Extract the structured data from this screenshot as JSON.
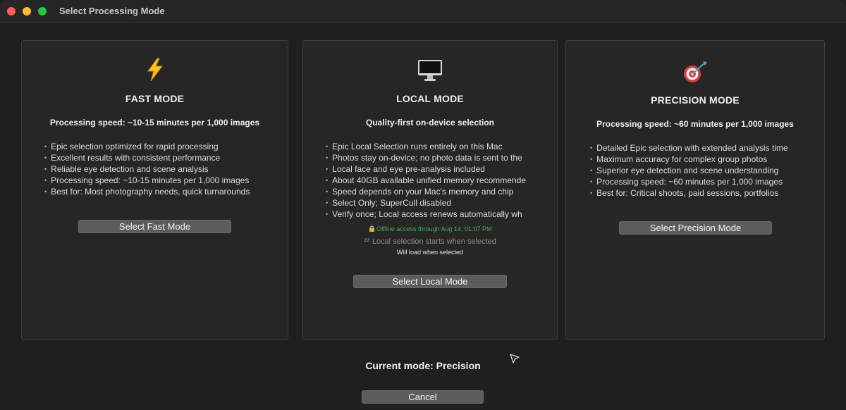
{
  "window": {
    "title": "Select Processing Mode"
  },
  "cards": {
    "fast": {
      "icon": "lightning-icon",
      "title": "FAST MODE",
      "subtitle": "Processing speed: ~10-15 minutes per 1,000 images",
      "bullets": [
        "Epic selection optimized for rapid processing",
        "Excellent results with consistent performance",
        "Reliable eye detection and scene analysis",
        "Processing speed: ~10-15 minutes per 1,000 images",
        "Best for: Most photography needs, quick turnarounds"
      ],
      "button": "Select Fast Mode"
    },
    "local": {
      "icon": "desktop-computer-icon",
      "title": "LOCAL MODE",
      "subtitle": "Quality-first on-device selection",
      "bullets": [
        "Epic Local Selection runs entirely on this Mac",
        "Photos stay on-device; no photo data is sent to the",
        "Local face and eye pre-analysis included",
        "About 40GB available unified memory recommende",
        "Speed depends on your Mac's memory and chip",
        "Select Only; SuperCull disabled",
        "Verify once; Local access renews automatically wh"
      ],
      "offline_status": "Offline access through Aug 14, 01:07 PM",
      "selection_status": "Local selection starts when selected",
      "load_status": "Will load when selected",
      "button": "Select Local Mode"
    },
    "precision": {
      "icon": "target-icon",
      "title": "PRECISION MODE",
      "subtitle": "Processing speed: ~60 minutes per 1,000 images",
      "bullets": [
        "Detailed Epic selection with extended analysis time",
        "Maximum accuracy for complex group photos",
        "Superior eye detection and scene understanding",
        "Processing speed: ~60 minutes per 1,000 images",
        "Best for: Critical shoots, paid sessions, portfolios"
      ],
      "button": "Select Precision Mode"
    }
  },
  "current_mode": "Current mode: Precision",
  "cancel_button": "Cancel",
  "colors": {
    "background": "#1f1f1f",
    "card": "#262626",
    "button": "#5d5b60",
    "offline_green": "#3fae4f"
  }
}
